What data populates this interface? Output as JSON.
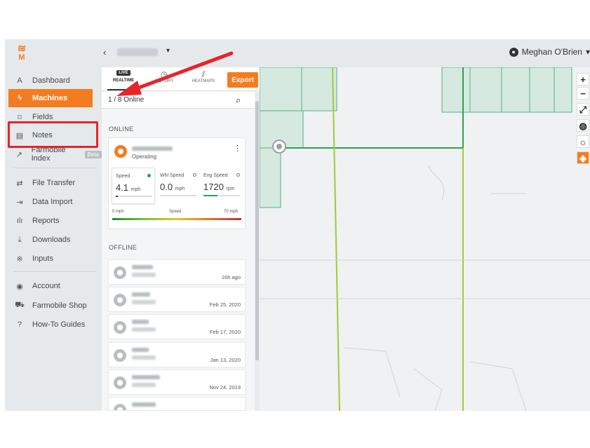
{
  "user": {
    "name": "Meghan O'Brien",
    "caret": "▾"
  },
  "topbar": {
    "back": "‹",
    "farm_caret": "▾"
  },
  "logo": {
    "letter": "M",
    "wifi": "≋"
  },
  "sidebar": {
    "items": [
      {
        "icon": "A",
        "label": "Dashboard"
      },
      {
        "icon": "ϟ",
        "label": "Machines"
      },
      {
        "icon": "⌑",
        "label": "Fields"
      },
      {
        "icon": "▤",
        "label": "Notes"
      },
      {
        "icon": "↗",
        "label": "Farmobile Index",
        "badge": "Beta"
      },
      {
        "icon": "⇄",
        "label": "File Transfer"
      },
      {
        "icon": "⇥",
        "label": "Data Import"
      },
      {
        "icon": "ılı",
        "label": "Reports"
      },
      {
        "icon": "⤓",
        "label": "Downloads"
      },
      {
        "icon": "※",
        "label": "Inputs"
      },
      {
        "icon": "◉",
        "label": "Account"
      },
      {
        "icon": "⛟",
        "label": "Farmobile Shop"
      },
      {
        "icon": "?",
        "label": "How-To Guides"
      }
    ]
  },
  "panel": {
    "tabs": {
      "live_badge": "LIVE",
      "realtime": "REALTIME",
      "history": "HISTORY",
      "heatmaps": "HEATMAPS"
    },
    "export": "Export",
    "online_count": "1 / 8 Online",
    "online_header": "ONLINE",
    "offline_header": "OFFLINE",
    "online_machine": {
      "status": "Operating",
      "stats": [
        {
          "label": "Speed",
          "value": "4.1",
          "unit": "mph",
          "fill": 0.06
        },
        {
          "label": "Whl Speed",
          "value": "0.0",
          "unit": "mph",
          "fill": 0
        },
        {
          "label": "Eng Speed",
          "value": "1720",
          "unit": "rpm",
          "fill": 0.38
        }
      ],
      "range": {
        "min": "0 mph",
        "label": "Speed",
        "max": "70 mph"
      }
    },
    "offline": [
      {
        "time": "16h ago"
      },
      {
        "time": "Feb 25, 2020"
      },
      {
        "time": "Feb 17, 2020"
      },
      {
        "time": "Jan 13, 2020"
      },
      {
        "time": "Nov 24, 2019"
      }
    ]
  },
  "map_controls": {
    "zoom_in": "+",
    "zoom_out": "−",
    "fullscreen": "⤢",
    "globe": "◍",
    "sun": "☼",
    "layers": "◈"
  },
  "colors": {
    "accent": "#f47c20",
    "highlight": "#e8232a",
    "field": "#d6e9e1",
    "road": "#9ccc3a"
  }
}
